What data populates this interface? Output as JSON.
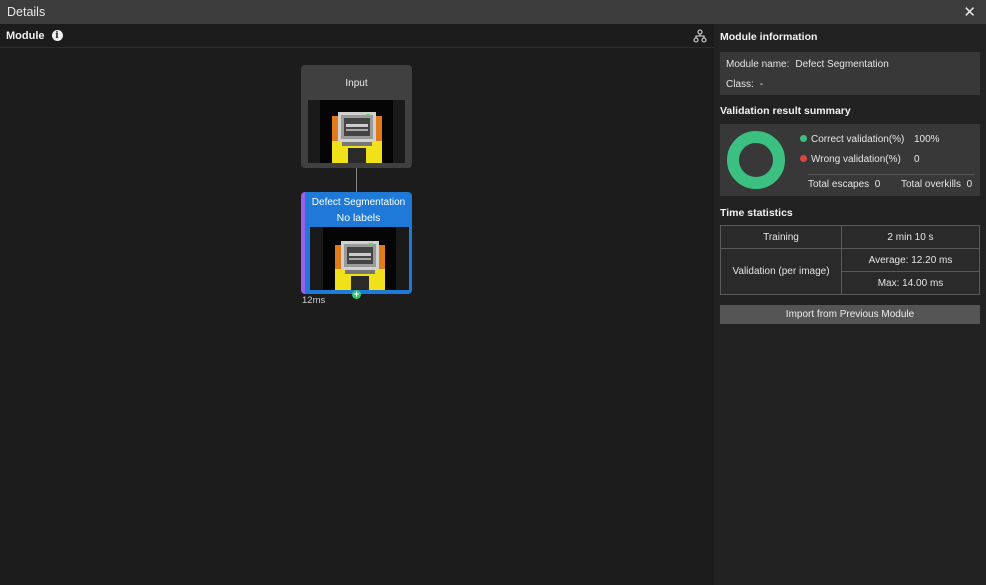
{
  "window": {
    "title": "Details"
  },
  "module_panel": {
    "title": "Module",
    "nodes": [
      {
        "label": "Input"
      },
      {
        "label": "Defect Segmentation",
        "sublabel": "No labels",
        "time": "12ms"
      }
    ]
  },
  "module_info": {
    "title": "Module information",
    "name_label": "Module name:",
    "name_value": "Defect Segmentation",
    "class_label": "Class:",
    "class_value": "-"
  },
  "validation": {
    "title": "Validation result summary",
    "correct_label": "Correct validation(%)",
    "correct_value": "100%",
    "wrong_label": "Wrong validation(%)",
    "wrong_value": "0",
    "escapes_label": "Total escapes",
    "escapes_value": "0",
    "overkills_label": "Total overkills",
    "overkills_value": "0",
    "correct_fraction": 1.0,
    "colors": {
      "correct": "#3cc081",
      "wrong": "#e0463d"
    }
  },
  "time_stats": {
    "title": "Time statistics",
    "training_label": "Training",
    "training_value": "2 min 10 s",
    "validation_label": "Validation (per image)",
    "average": "Average: 12.20 ms",
    "max": "Max: 14.00 ms"
  },
  "import_button": {
    "label": "Import from Previous Module"
  },
  "colors": {
    "accent": "#1e7ad6",
    "accent_border": "#9b5cf0"
  }
}
